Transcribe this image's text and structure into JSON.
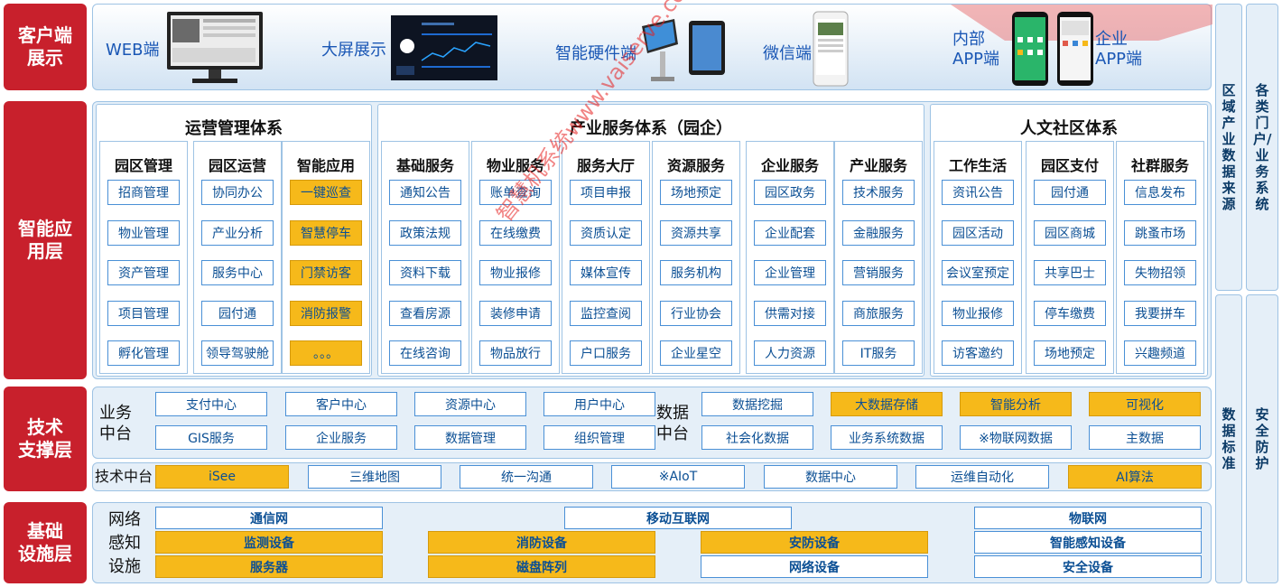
{
  "layers": {
    "client": "客户端\n展示",
    "smart": "智能应\n用层",
    "tech": "技术\n支撑层",
    "infra": "基础\n设施层"
  },
  "clients": {
    "web": "WEB端",
    "bigscreen": "大屏展示",
    "hardware": "智能硬件端",
    "wechat": "微信端",
    "internal_app": "内部\nAPP端",
    "enterprise_app": "企业\nAPP端"
  },
  "sections": {
    "ops": "运营管理体系",
    "industry": "产业服务体系（园企）",
    "community": "人文社区体系"
  },
  "columns": [
    {
      "title": "园区管理",
      "items": [
        "招商管理",
        "物业管理",
        "资产管理",
        "项目管理",
        "孵化管理"
      ],
      "hl": []
    },
    {
      "title": "园区运营",
      "items": [
        "协同办公",
        "产业分析",
        "服务中心",
        "园付通",
        "领导驾驶舱"
      ],
      "hl": []
    },
    {
      "title": "智能应用",
      "items": [
        "一键巡查",
        "智慧停车",
        "门禁访客",
        "消防报警",
        "。。。"
      ],
      "hl": [
        0,
        1,
        2,
        3,
        4
      ]
    },
    {
      "title": "基础服务",
      "items": [
        "通知公告",
        "政策法规",
        "资料下载",
        "查看房源",
        "在线咨询"
      ],
      "hl": []
    },
    {
      "title": "物业服务",
      "items": [
        "账单查询",
        "在线缴费",
        "物业报修",
        "装修申请",
        "物品放行"
      ],
      "hl": []
    },
    {
      "title": "服务大厅",
      "items": [
        "项目申报",
        "资质认定",
        "媒体宣传",
        "监控查阅",
        "户口服务"
      ],
      "hl": []
    },
    {
      "title": "资源服务",
      "items": [
        "场地预定",
        "资源共享",
        "服务机构",
        "行业协会",
        "企业星空"
      ],
      "hl": []
    },
    {
      "title": "企业服务",
      "items": [
        "园区政务",
        "企业配套",
        "企业管理",
        "供需对接",
        "人力资源"
      ],
      "hl": []
    },
    {
      "title": "产业服务",
      "items": [
        "技术服务",
        "金融服务",
        "营销服务",
        "商旅服务",
        "IT服务"
      ],
      "hl": []
    },
    {
      "title": "工作生活",
      "items": [
        "资讯公告",
        "园区活动",
        "会议室预定",
        "物业报修",
        "访客邀约"
      ],
      "hl": []
    },
    {
      "title": "园区支付",
      "items": [
        "园付通",
        "园区商城",
        "共享巴士",
        "停车缴费",
        "场地预定"
      ],
      "hl": []
    },
    {
      "title": "社群服务",
      "items": [
        "信息发布",
        "跳蚤市场",
        "失物招领",
        "我要拼车",
        "兴趣频道"
      ],
      "hl": []
    }
  ],
  "business_platform": {
    "label": "业务\n中台",
    "row1": [
      "支付中心",
      "客户中心",
      "资源中心",
      "用户中心"
    ],
    "row2": [
      "GIS服务",
      "企业服务",
      "数据管理",
      "组织管理"
    ]
  },
  "data_platform": {
    "label": "数据\n中台",
    "row1": [
      "数据挖掘",
      "大数据存储",
      "智能分析",
      "可视化"
    ],
    "row1_hl": [
      1,
      2,
      3
    ],
    "row2": [
      "社会化数据",
      "业务系统数据",
      "※物联网数据",
      "主数据"
    ]
  },
  "tech_platform": {
    "label": "技术中台",
    "items": [
      "iSee",
      "三维地图",
      "统一沟通",
      "※AIoT",
      "数据中心",
      "运维自动化",
      "AI算法"
    ],
    "hl": [
      0,
      6
    ]
  },
  "infra_label": "网络\n感知\n设施",
  "infra_rows": [
    {
      "items": [
        "通信网",
        "",
        "移动互联网",
        "",
        "物联网"
      ],
      "hl": []
    },
    {
      "items": [
        "监测设备",
        "消防设备",
        "安防设备",
        "智能感知设备"
      ],
      "hl": [
        0,
        1,
        2
      ]
    },
    {
      "items": [
        "服务器",
        "磁盘阵列",
        "网络设备",
        "安全设备"
      ],
      "hl": [
        0,
        1
      ]
    }
  ],
  "side": {
    "regional_data": "区域产业数据来源",
    "portals": "各类门户/业务系统",
    "data_standard": "数据标准",
    "security": "安全防护"
  },
  "watermark": "智慧机系统www.vaiserve.com",
  "colors": {
    "accent_red": "#c8202c",
    "highlight": "#f6b91a",
    "text_blue": "#0b4f94"
  }
}
